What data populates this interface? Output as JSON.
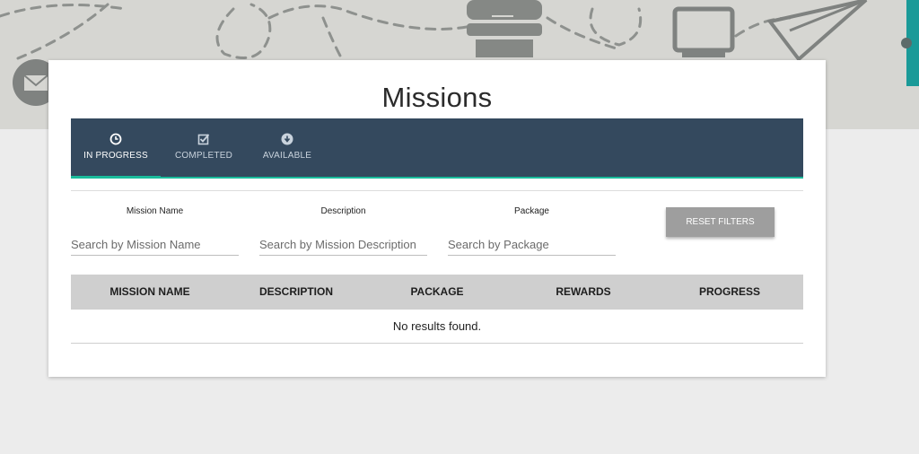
{
  "page": {
    "title": "Missions"
  },
  "tabs": [
    {
      "label": "IN PROGRESS",
      "icon": "clock-icon",
      "active": true
    },
    {
      "label": "COMPLETED",
      "icon": "checkbox-icon",
      "active": false
    },
    {
      "label": "AVAILABLE",
      "icon": "download-circle-icon",
      "active": false
    }
  ],
  "filters": {
    "mission_name": {
      "label": "Mission Name",
      "placeholder": "Search by Mission Name",
      "value": ""
    },
    "description": {
      "label": "Description",
      "placeholder": "Search by Mission Description",
      "value": ""
    },
    "package": {
      "label": "Package",
      "placeholder": "Search by Package",
      "value": ""
    },
    "reset_label": "RESET FILTERS"
  },
  "table": {
    "columns": [
      "MISSION NAME",
      "DESCRIPTION",
      "PACKAGE",
      "REWARDS",
      "PROGRESS"
    ],
    "empty_message": "No results found."
  },
  "colors": {
    "tabbar": "#34495e",
    "accent": "#1abc9c",
    "reset_button": "#9e9e9e",
    "table_header": "#cfcfcf"
  }
}
